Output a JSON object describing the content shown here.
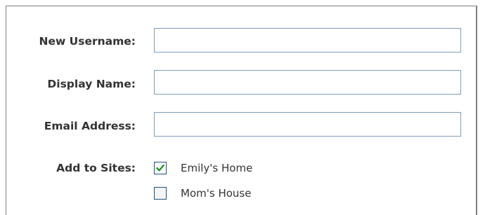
{
  "form": {
    "username": {
      "label": "New Username:",
      "value": "",
      "placeholder": ""
    },
    "display_name": {
      "label": "Display Name:",
      "value": "",
      "placeholder": ""
    },
    "email": {
      "label": "Email Address:",
      "value": "",
      "placeholder": ""
    },
    "sites": {
      "label": "Add to Sites:",
      "options": [
        {
          "label": "Emily's Home",
          "checked": true
        },
        {
          "label": "Mom's House",
          "checked": false
        }
      ]
    }
  },
  "colors": {
    "label_text": "#333333",
    "input_border": "#7f9db9",
    "checkbox_border": "#1c5180",
    "check_mark": "#1e8a1e"
  }
}
